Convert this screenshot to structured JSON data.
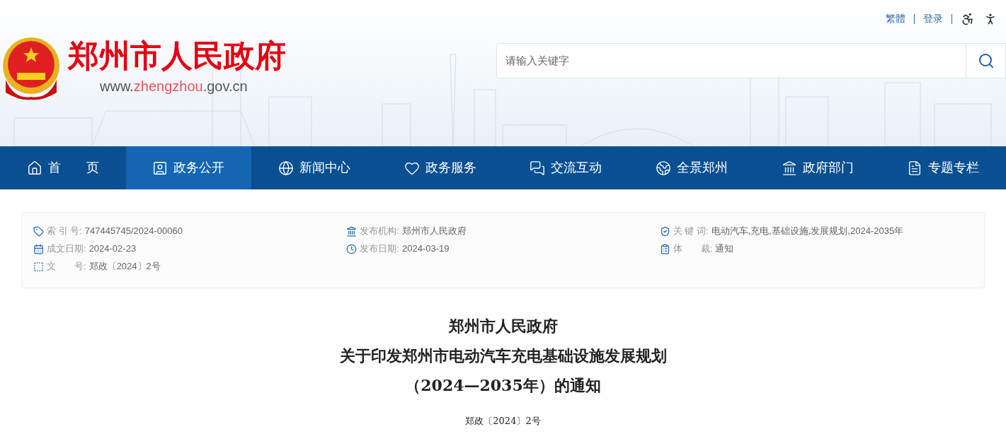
{
  "top_links": [
    {
      "label": "繁體"
    },
    {
      "label": "登录"
    }
  ],
  "logo": {
    "title": "郑州市人民政府",
    "url_parts": [
      {
        "text": "www.",
        "highlight": false
      },
      {
        "text": "zhengzhou",
        "highlight": true
      },
      {
        "text": ".gov.cn",
        "highlight": false
      }
    ]
  },
  "search": {
    "placeholder": "请输入关键字"
  },
  "nav": [
    {
      "label": "首　　页",
      "selected": false
    },
    {
      "label": "政务公开",
      "selected": true
    },
    {
      "label": "新闻中心",
      "selected": false
    },
    {
      "label": "政务服务",
      "selected": false
    },
    {
      "label": "交流互动",
      "selected": false
    },
    {
      "label": "全景郑州",
      "selected": false
    },
    {
      "label": "政府部门",
      "selected": false
    },
    {
      "label": "专题专栏",
      "selected": false
    }
  ],
  "meta": [
    [
      {
        "label": "索 引 号:",
        "value": "747445745/2024-00060"
      },
      {
        "label": "成文日期:",
        "value": "2024-02-23"
      },
      {
        "label": "文　　号:",
        "value": "郑政〔2024〕2号"
      }
    ],
    [
      {
        "label": "发布机构:",
        "value": "郑州市人民政府"
      },
      {
        "label": "发布日期:",
        "value": "2024-03-19"
      }
    ],
    [
      {
        "label": "关 键 词:",
        "value": "电动汽车,充电,基础设施,发展规划,2024-2035年"
      },
      {
        "label": "体　　裁:",
        "value": "通知"
      }
    ]
  ],
  "document": {
    "title_lines": [
      "郑州市人民政府",
      "关于印发郑州市电动汽车充电基础设施发展规划",
      "（2024—2035年）的通知"
    ],
    "doc_number": "郑政〔2024〕2号"
  }
}
